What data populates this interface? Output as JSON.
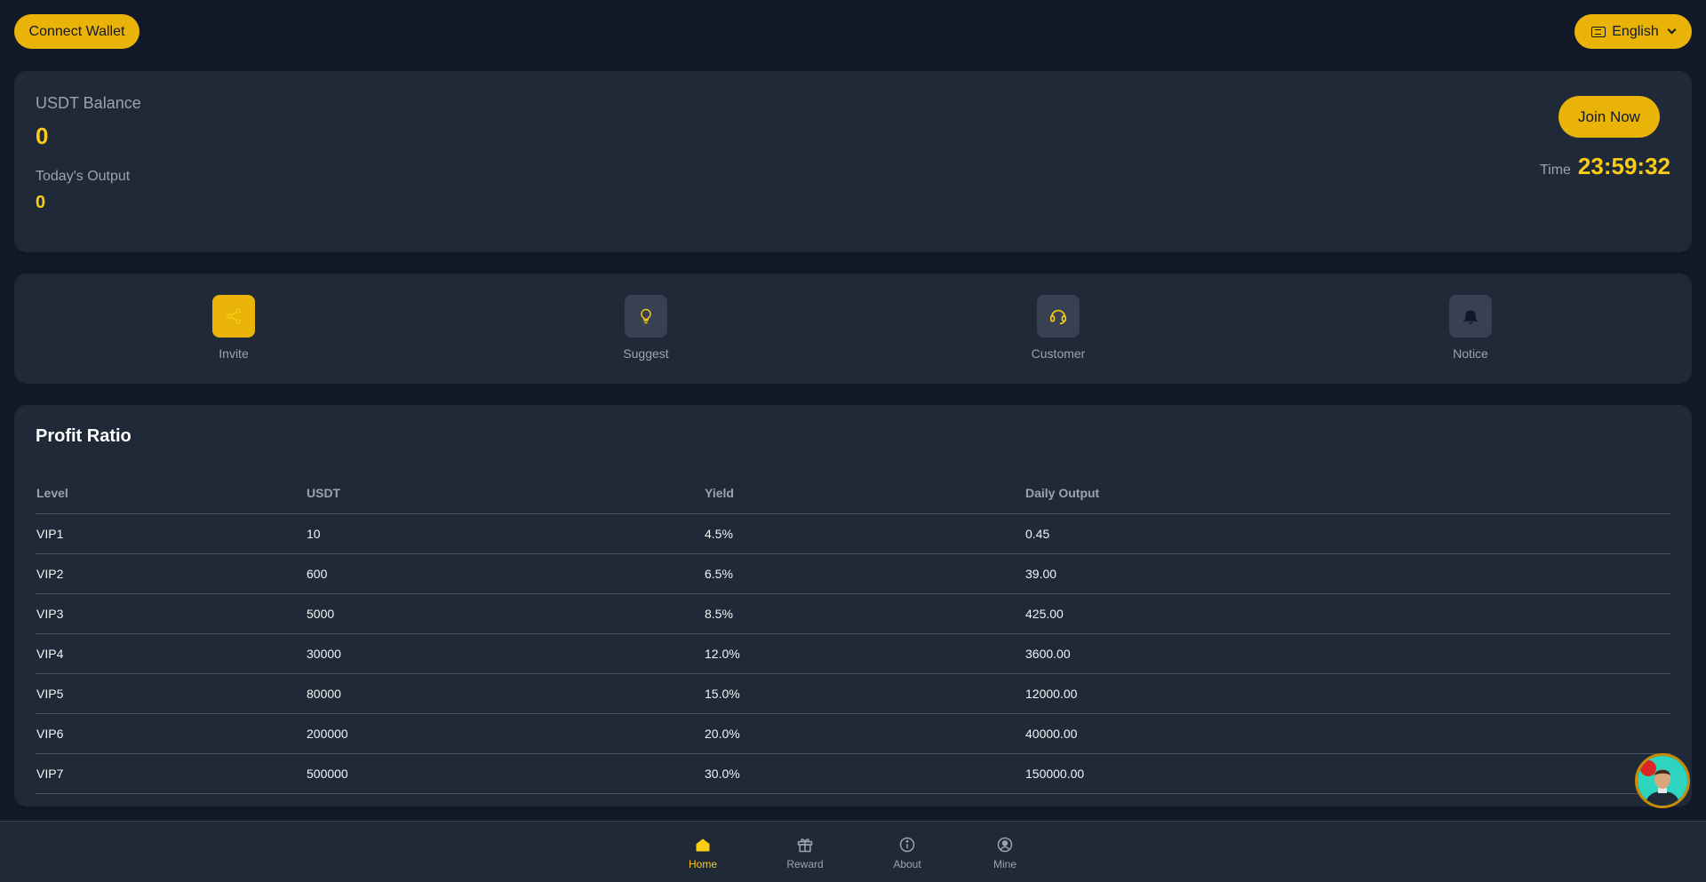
{
  "header": {
    "connect_label": "Connect Wallet",
    "language_label": "English"
  },
  "balance": {
    "usdt_label": "USDT Balance",
    "usdt_value": "0",
    "output_label": "Today's Output",
    "output_value": "0",
    "join_label": "Join Now",
    "time_label": "Time",
    "time_value": "23:59:32"
  },
  "actions": [
    {
      "label": "Invite",
      "icon": "share-icon"
    },
    {
      "label": "Suggest",
      "icon": "lightbulb-icon"
    },
    {
      "label": "Customer",
      "icon": "headset-icon"
    },
    {
      "label": "Notice",
      "icon": "bell-icon"
    }
  ],
  "profit": {
    "title": "Profit Ratio",
    "columns": [
      "Level",
      "USDT",
      "Yield",
      "Daily Output"
    ],
    "rows": [
      [
        "VIP1",
        "10",
        "4.5%",
        "0.45"
      ],
      [
        "VIP2",
        "600",
        "6.5%",
        "39.00"
      ],
      [
        "VIP3",
        "5000",
        "8.5%",
        "425.00"
      ],
      [
        "VIP4",
        "30000",
        "12.0%",
        "3600.00"
      ],
      [
        "VIP5",
        "80000",
        "15.0%",
        "12000.00"
      ],
      [
        "VIP6",
        "200000",
        "20.0%",
        "40000.00"
      ],
      [
        "VIP7",
        "500000",
        "30.0%",
        "150000.00"
      ]
    ]
  },
  "nav": [
    {
      "label": "Home",
      "icon": "home-icon"
    },
    {
      "label": "Reward",
      "icon": "gift-icon"
    },
    {
      "label": "About",
      "icon": "info-icon"
    },
    {
      "label": "Mine",
      "icon": "user-icon"
    }
  ],
  "colors": {
    "accent": "#eab308",
    "background": "#111827",
    "card": "#1f2937",
    "yield_green": "#4ade80"
  }
}
